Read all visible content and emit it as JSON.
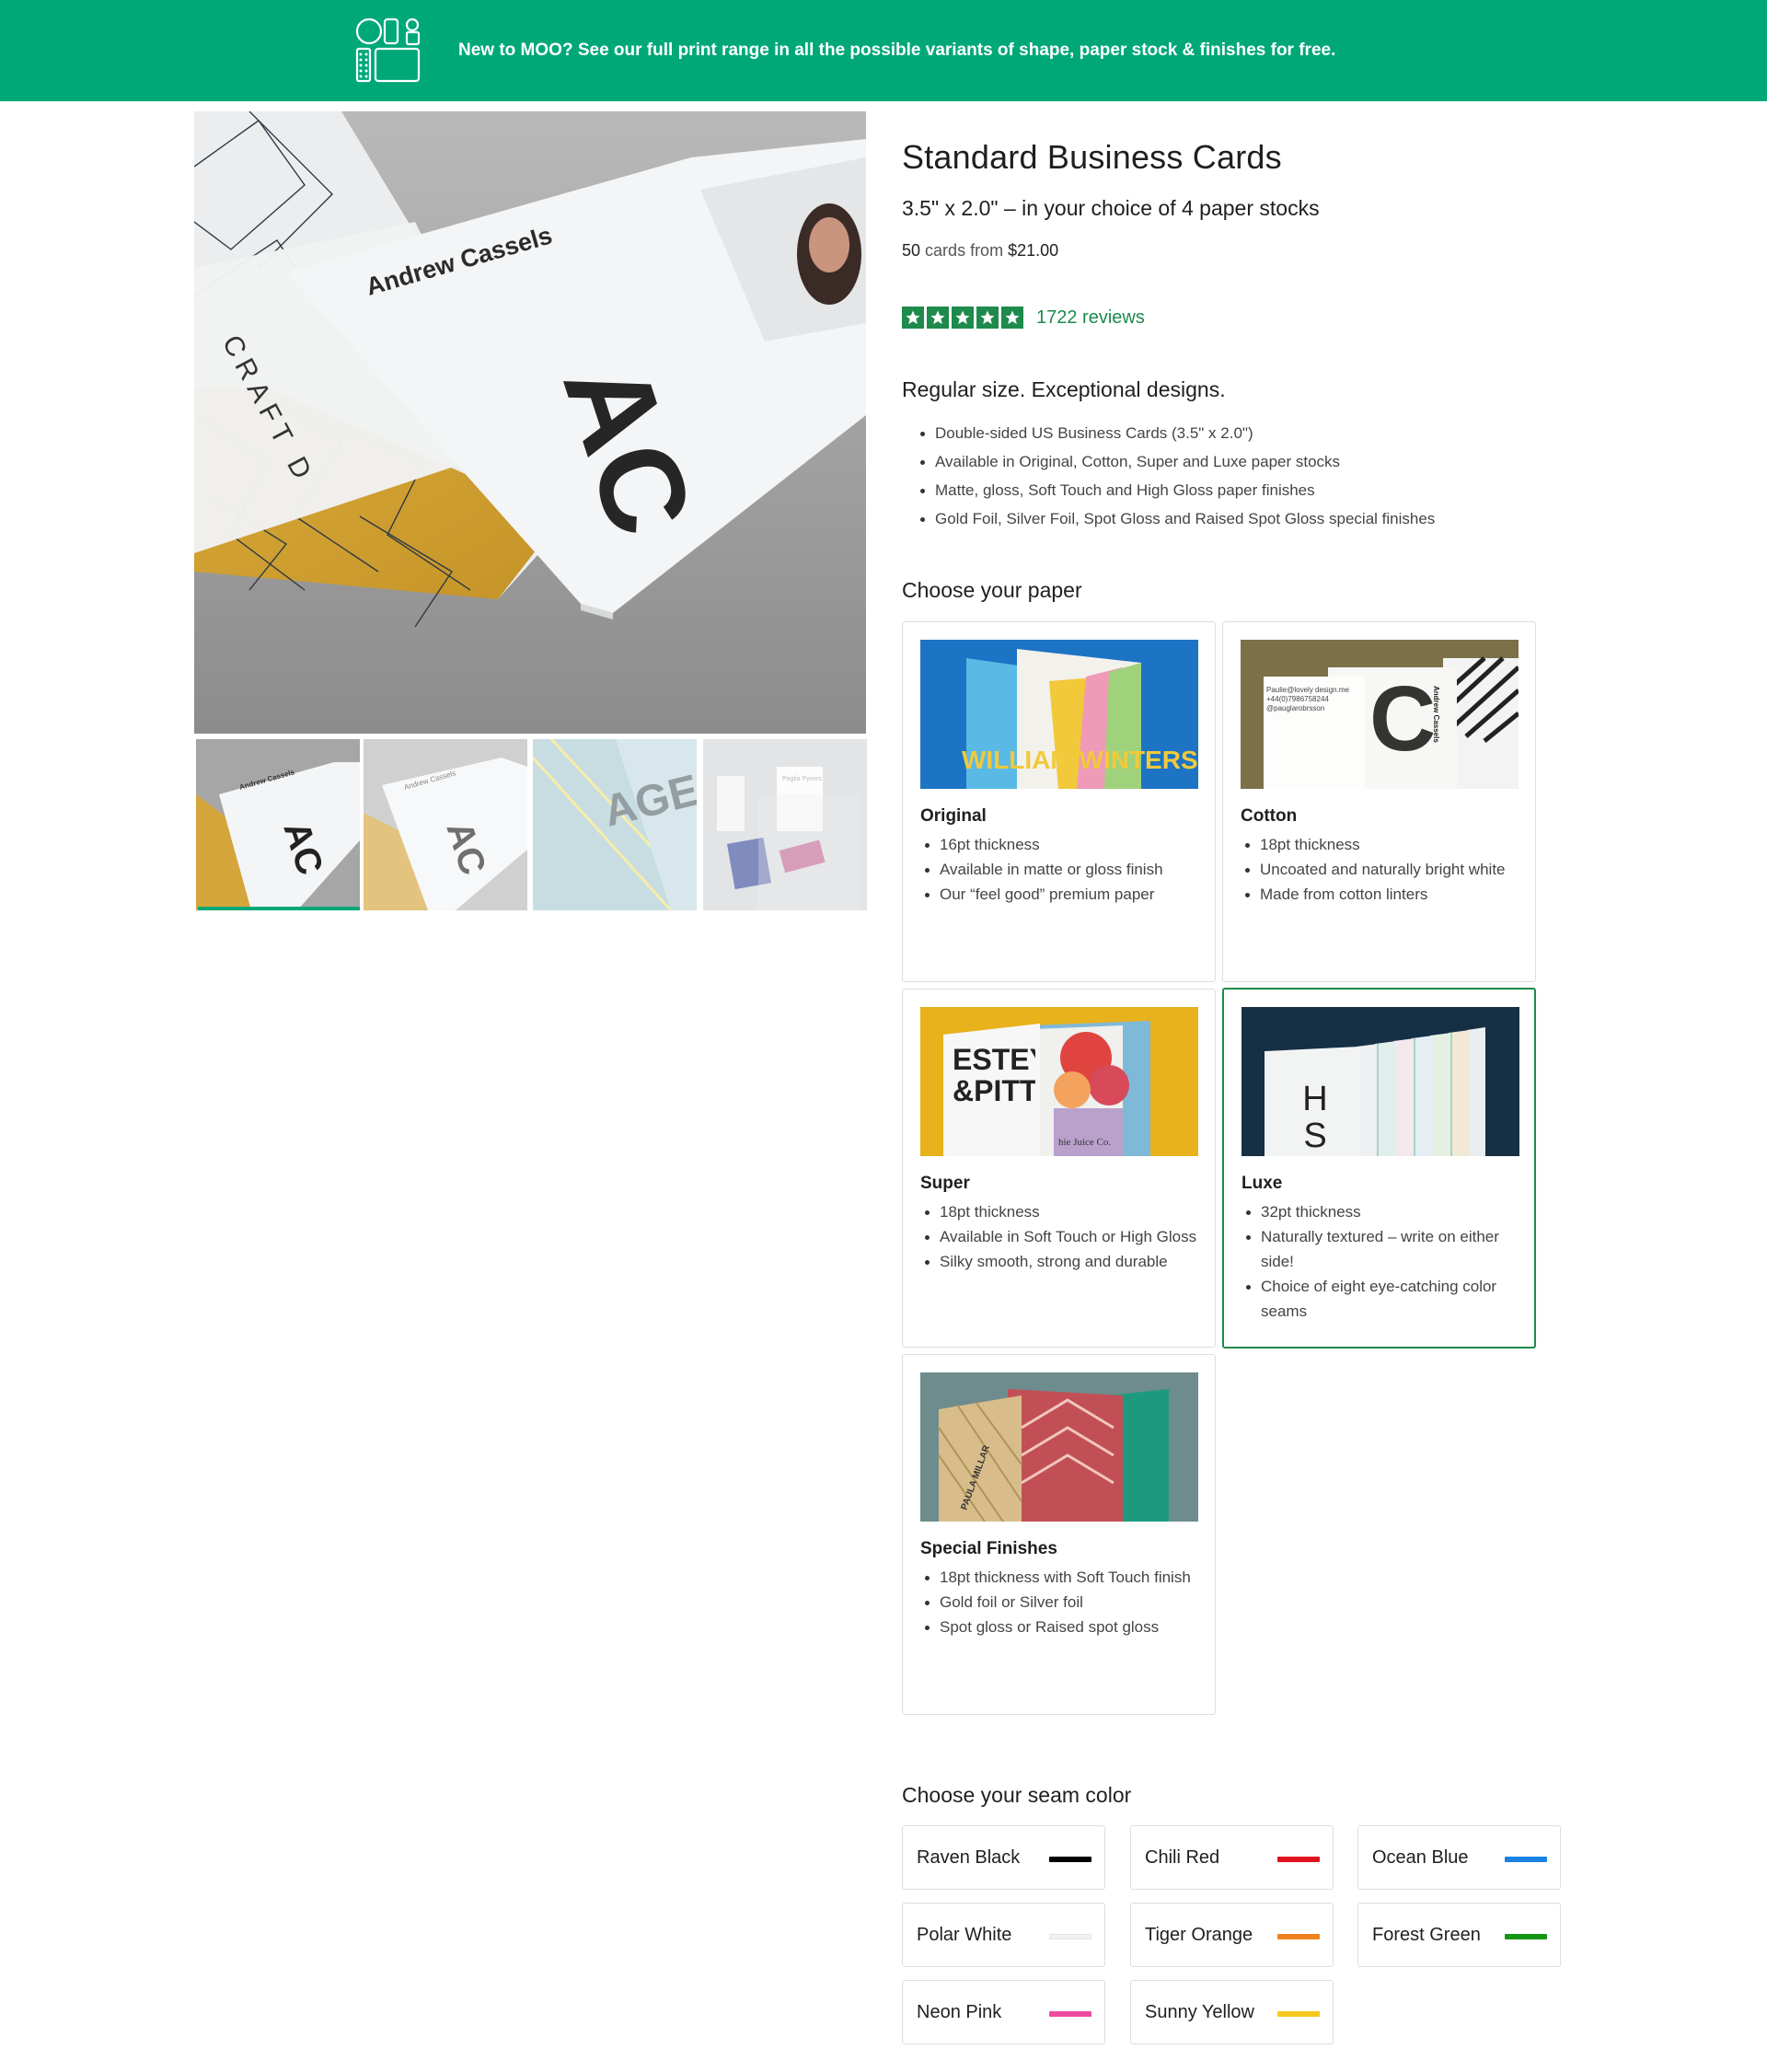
{
  "banner": {
    "text": "New to MOO? See our full print range in all the possible variants of shape, paper stock & finishes for free.",
    "background": "#00a878",
    "icon": "shapes-logo-icon"
  },
  "gallery": {
    "main_card_name": "Andrew Cassels",
    "main_card_monogram": "AC",
    "main_card_back_text": "CRAFT D",
    "thumbnails": [
      {
        "label": "AC",
        "name": "Andrew Cassels",
        "selected": true
      },
      {
        "label": "AC",
        "name": "Andrew Cassels",
        "selected": false
      },
      {
        "label": "AGEN",
        "selected": false
      },
      {
        "label": "Paglia Pyvers",
        "selected": false
      }
    ]
  },
  "product": {
    "title": "Standard Business Cards",
    "subtitle": "3.5\" x 2.0\" – in your choice of 4 paper stocks",
    "quantity": "50",
    "cards_from": "cards from",
    "price": "$21.00",
    "rating": 5,
    "reviews": "1722 reviews"
  },
  "features": {
    "heading": "Regular size. Exceptional designs.",
    "items": [
      "Double-sided US Business Cards (3.5\" x 2.0\")",
      "Available in Original, Cotton, Super and Luxe paper stocks",
      "Matte, gloss, Soft Touch and High Gloss paper finishes",
      "Gold Foil, Silver Foil, Spot Gloss and Raised Spot Gloss special finishes"
    ]
  },
  "paper": {
    "heading": "Choose your paper",
    "options": [
      {
        "name": "Original",
        "image_text": "WILLIAM WINTERS",
        "bullets": [
          "16pt thickness",
          "Available in matte or gloss finish",
          "Our “feel good” premium paper"
        ],
        "selected": false
      },
      {
        "name": "Cotton",
        "image_text": "Paulie@lovely design.me +44(0)7986758244 @pauglarobrsson",
        "image_side_text": "Andrew Cassels",
        "bullets": [
          "18pt thickness",
          "Uncoated and naturally bright white",
          "Made from cotton linters"
        ],
        "selected": false
      },
      {
        "name": "Super",
        "image_text": "ESTEY &PITT",
        "image_small_text": "hie Juice Co.",
        "bullets": [
          "18pt thickness",
          "Available in Soft Touch or High Gloss",
          "Silky smooth, strong and durable"
        ],
        "selected": false
      },
      {
        "name": "Luxe",
        "image_text": "H S",
        "bullets": [
          "32pt thickness",
          "Naturally textured – write on either side!",
          "Choice of eight eye-catching color seams"
        ],
        "selected": true
      },
      {
        "name": "Special Finishes",
        "image_text": "PAULA MILLAR",
        "bullets": [
          "18pt thickness with Soft Touch finish",
          "Gold foil or Silver foil",
          "Spot gloss or Raised spot gloss"
        ],
        "selected": false
      }
    ]
  },
  "seam": {
    "heading": "Choose your seam color",
    "colors": [
      {
        "name": "Raven Black",
        "hex": "#000000"
      },
      {
        "name": "Chili Red",
        "hex": "#e0141e"
      },
      {
        "name": "Ocean Blue",
        "hex": "#1a82e2"
      },
      {
        "name": "Polar White",
        "hex": "#f2f2f2"
      },
      {
        "name": "Tiger Orange",
        "hex": "#f0821e"
      },
      {
        "name": "Forest Green",
        "hex": "#149614"
      },
      {
        "name": "Neon Pink",
        "hex": "#ee4a9e"
      },
      {
        "name": "Sunny Yellow",
        "hex": "#f5c81e"
      }
    ]
  },
  "colors": {
    "brand_green": "#00a878",
    "accent_green": "#1e8a4c"
  }
}
